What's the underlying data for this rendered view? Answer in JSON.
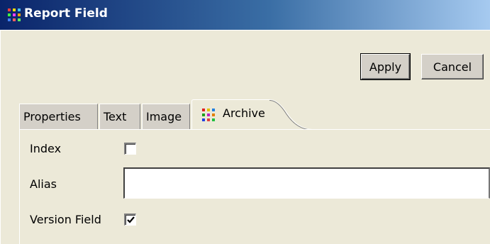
{
  "window": {
    "title": "Report Field",
    "icon": "grid-dots-icon"
  },
  "toolbar": {
    "apply_label": "Apply",
    "cancel_label": "Cancel"
  },
  "tabs": [
    {
      "label": "Properties",
      "active": false
    },
    {
      "label": "Text",
      "active": false
    },
    {
      "label": "Image",
      "active": false
    },
    {
      "label": "Archive",
      "active": true,
      "icon": "grid-dots-icon"
    }
  ],
  "archive": {
    "index": {
      "label": "Index",
      "checked": false
    },
    "alias": {
      "label": "Alias",
      "value": "",
      "placeholder": ""
    },
    "version_field": {
      "label": "Version Field",
      "checked": true
    }
  },
  "colors": {
    "title_bar_start": "#0a246a",
    "title_bar_end": "#a6caf0",
    "dialog_bg": "#ece9d8"
  }
}
